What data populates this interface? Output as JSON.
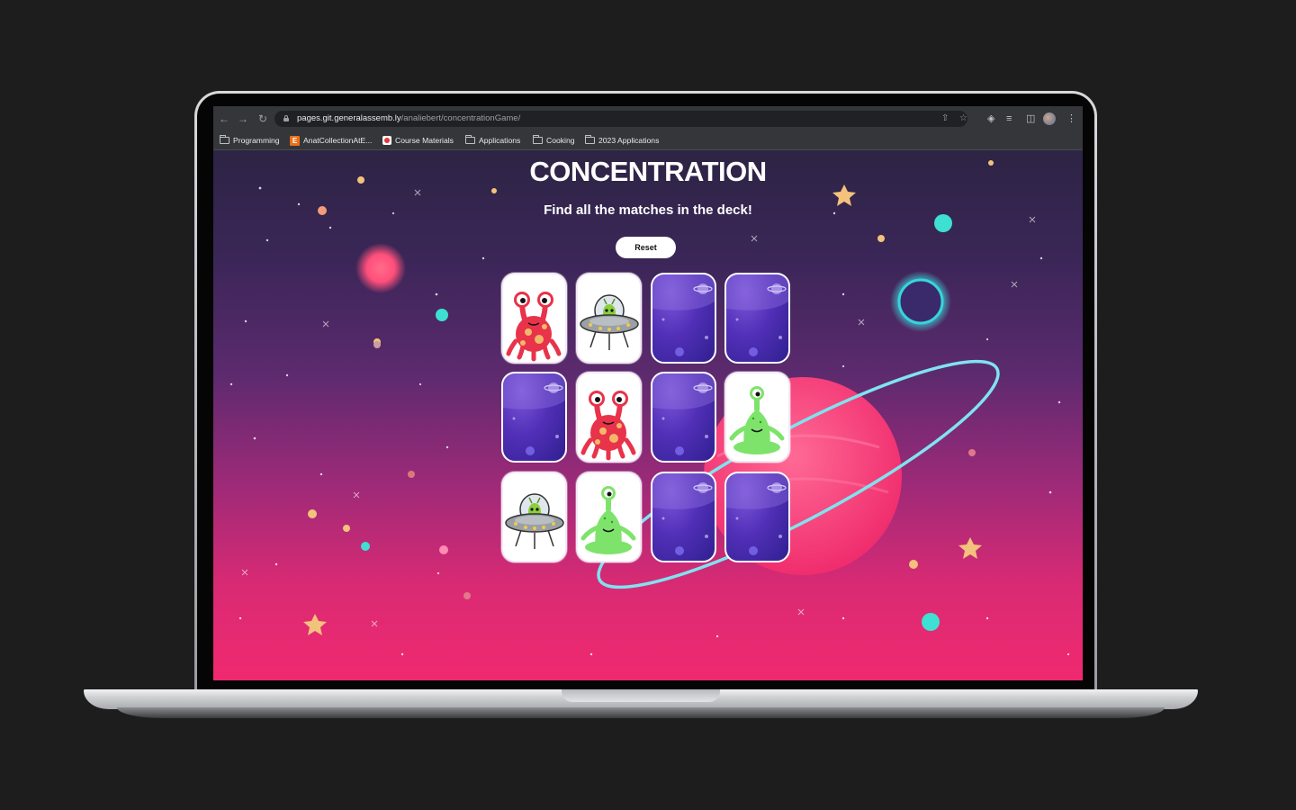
{
  "browser": {
    "url_host": "pages.git.generalassemb.ly",
    "url_path": "/analiebert/concentrationGame/",
    "bookmarks": [
      {
        "label": "Programming",
        "icon": "folder-icon"
      },
      {
        "label": "AnatCollectionAtE...",
        "icon": "etsy-favicon"
      },
      {
        "label": "Course Materials",
        "icon": "course-favicon"
      },
      {
        "label": "Applications",
        "icon": "folder-icon"
      },
      {
        "label": "Cooking",
        "icon": "folder-icon"
      },
      {
        "label": "2023 Applications",
        "icon": "folder-icon"
      }
    ]
  },
  "game": {
    "title": "CONCENTRATION",
    "subtitle": "Find all the matches in the deck!",
    "reset_label": "Reset",
    "cards": [
      {
        "state": "face",
        "alien": "red-alien"
      },
      {
        "state": "face",
        "alien": "ufo-alien"
      },
      {
        "state": "back",
        "alien": ""
      },
      {
        "state": "back",
        "alien": ""
      },
      {
        "state": "back",
        "alien": ""
      },
      {
        "state": "face",
        "alien": "red-alien"
      },
      {
        "state": "back",
        "alien": ""
      },
      {
        "state": "face",
        "alien": "green-alien"
      },
      {
        "state": "face",
        "alien": "ufo-alien"
      },
      {
        "state": "face",
        "alien": "green-alien"
      },
      {
        "state": "back",
        "alien": ""
      },
      {
        "state": "back",
        "alien": ""
      }
    ]
  },
  "colors": {
    "background_top": "#2d2444",
    "background_bottom": "#f0296f",
    "card_back": "#5230b8",
    "planet": "#f03e78",
    "ring": "#7fe3f0"
  }
}
